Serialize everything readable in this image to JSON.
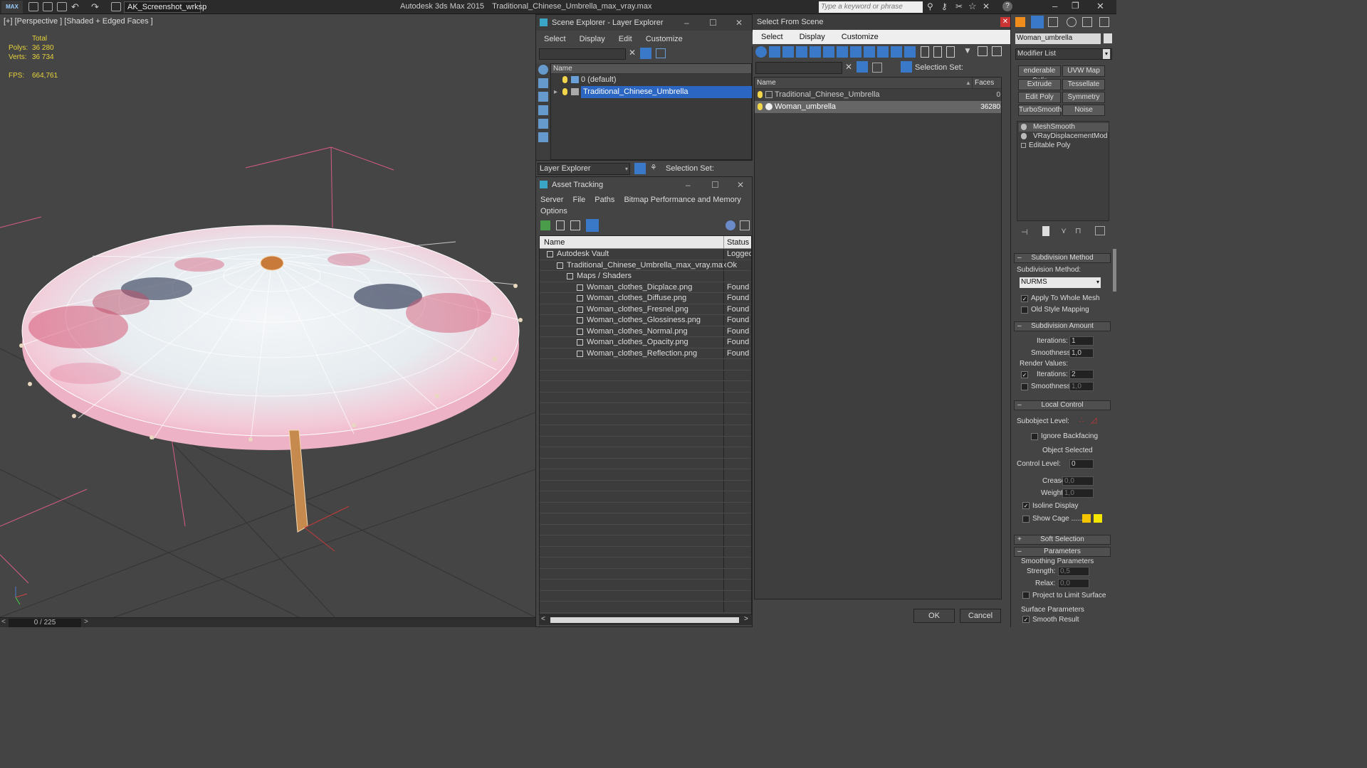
{
  "titlebar": {
    "logo": "MAX",
    "workspace": "AK_Screenshot_wrksp",
    "app_title": "Autodesk 3ds Max  2015",
    "file_name": "Traditional_Chinese_Umbrella_max_vray.max",
    "search_placeholder": "Type a keyword or phrase"
  },
  "viewport": {
    "label": "[+] [Perspective ] [Shaded + Edged Faces ]",
    "stats": {
      "total_label": "Total",
      "polys_label": "Polys:",
      "polys_value": "36 280",
      "verts_label": "Verts:",
      "verts_value": "36 734",
      "fps_label": "FPS:",
      "fps_value": "664,761"
    },
    "time_slider": "0 / 225"
  },
  "scene_explorer": {
    "title": "Scene Explorer - Layer Explorer",
    "menu": [
      "Select",
      "Display",
      "Edit",
      "Customize"
    ],
    "column_name": "Name",
    "rows": [
      {
        "label": "0 (default)",
        "selected": false
      },
      {
        "label": "Traditional_Chinese_Umbrella",
        "selected": true
      }
    ],
    "footer_dropdown": "Layer Explorer",
    "selection_set_label": "Selection Set:"
  },
  "asset_tracking": {
    "title": "Asset Tracking",
    "menu": [
      "Server",
      "File",
      "Paths",
      "Bitmap Performance and Memory",
      "Options"
    ],
    "col_name": "Name",
    "col_status": "Status",
    "rows": [
      {
        "name": "Autodesk Vault",
        "status": "Logged",
        "indent": 1
      },
      {
        "name": "Traditional_Chinese_Umbrella_max_vray.max",
        "status": "Ok",
        "indent": 2
      },
      {
        "name": "Maps / Shaders",
        "status": "",
        "indent": 3
      },
      {
        "name": "Woman_clothes_Dicplace.png",
        "status": "Found",
        "indent": 4
      },
      {
        "name": "Woman_clothes_Diffuse.png",
        "status": "Found",
        "indent": 4
      },
      {
        "name": "Woman_clothes_Fresnel.png",
        "status": "Found",
        "indent": 4
      },
      {
        "name": "Woman_clothes_Glossiness.png",
        "status": "Found",
        "indent": 4
      },
      {
        "name": "Woman_clothes_Normal.png",
        "status": "Found",
        "indent": 4
      },
      {
        "name": "Woman_clothes_Opacity.png",
        "status": "Found",
        "indent": 4
      },
      {
        "name": "Woman_clothes_Reflection.png",
        "status": "Found",
        "indent": 4
      }
    ]
  },
  "select_from_scene": {
    "title": "Select From Scene",
    "menu": [
      "Select",
      "Display",
      "Customize"
    ],
    "selection_set_label": "Selection Set:",
    "col_name": "Name",
    "col_faces": "Faces",
    "rows": [
      {
        "name": "Traditional_Chinese_Umbrella",
        "faces": "0"
      },
      {
        "name": "Woman_umbrella",
        "faces": "36280"
      }
    ],
    "ok": "OK",
    "cancel": "Cancel"
  },
  "command_panel": {
    "object_name": "Woman_umbrella",
    "modifier_list": "Modifier List",
    "buttons": [
      "enderable Splir",
      "UVW Map",
      "Extrude",
      "Tessellate",
      "Edit Poly",
      "Symmetry",
      "TurboSmooth",
      "Noise"
    ],
    "stack": [
      "MeshSmooth",
      "VRayDisplacementMod",
      "Editable Poly"
    ],
    "subdivision_method": {
      "rollout": "Subdivision Method",
      "label": "Subdivision Method:",
      "value": "NURMS",
      "apply_whole_mesh": "Apply To Whole Mesh",
      "old_style_mapping": "Old Style Mapping"
    },
    "subdivision_amount": {
      "rollout": "Subdivision Amount",
      "iterations_label": "Iterations:",
      "iterations_value": "1",
      "smoothness_label": "Smoothness:",
      "smoothness_value": "1,0",
      "render_values": "Render Values:",
      "render_iterations_value": "2",
      "render_smoothness_value": "1,0"
    },
    "local_control": {
      "rollout": "Local Control",
      "subobject_label": "Subobject Level:",
      "ignore_backfacing": "Ignore Backfacing",
      "object_selected": "Object Selected",
      "control_level_label": "Control Level:",
      "control_level_value": "0",
      "crease_label": "Crease:",
      "crease_value": "0,0",
      "weight_label": "Weight:",
      "weight_value": "1,0",
      "isoline_display": "Isoline Display",
      "show_cage": "Show Cage ......"
    },
    "soft_selection": "Soft Selection",
    "parameters": {
      "rollout": "Parameters",
      "smoothing_params": "Smoothing Parameters",
      "strength_label": "Strength:",
      "strength_value": "0,5",
      "relax_label": "Relax:",
      "relax_value": "0,0",
      "project_limit": "Project to Limit Surface",
      "surface_params": "Surface Parameters",
      "smooth_result": "Smooth Result"
    }
  },
  "colors": {
    "selection_blue": "#2a66c2",
    "stat_yellow": "#e8d33a",
    "umbrella_pink": "#f2c3d2",
    "cage_yellow": "#f5c400"
  }
}
